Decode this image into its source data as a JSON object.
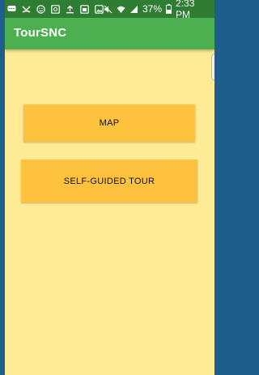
{
  "status_bar": {
    "battery_percent": "37%",
    "time": "2:33 PM",
    "icons": [
      "message-icon",
      "missed-call-icon",
      "smiley-icon",
      "image-icon",
      "upload-icon",
      "gallery-icon",
      "photo-icon",
      "mute-icon",
      "wifi-icon",
      "signal-icon",
      "battery-icon"
    ]
  },
  "app_bar": {
    "title": "TourSNC"
  },
  "buttons": {
    "map": "MAP",
    "self_guided_tour": "SELF-GUIDED TOUR"
  },
  "colors": {
    "status_bar": "#2e7d32",
    "app_bar": "#4caf50",
    "background": "#ffea96",
    "button": "#ffc23f",
    "frame": "#1d5e8c"
  }
}
